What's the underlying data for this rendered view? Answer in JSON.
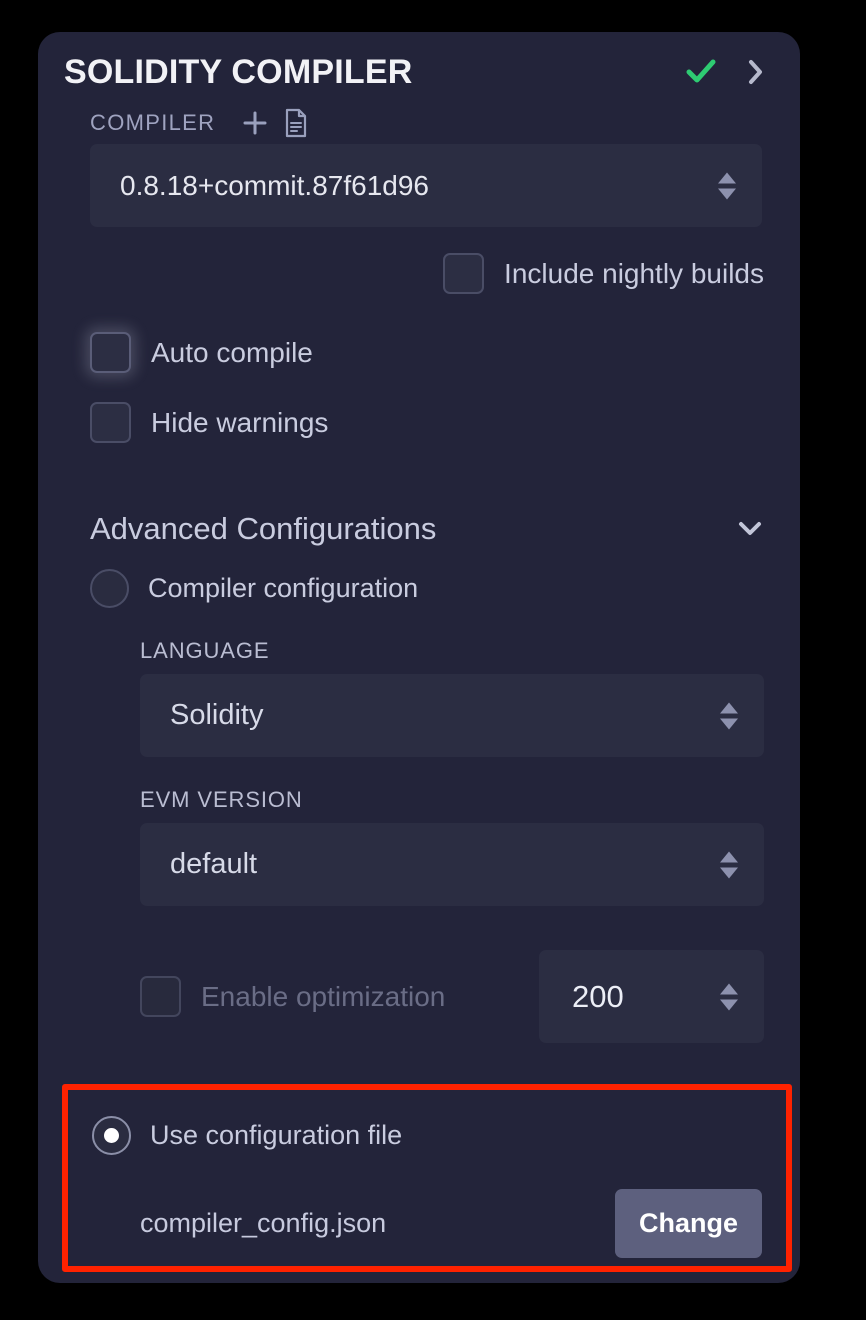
{
  "header": {
    "title": "SOLIDITY COMPILER",
    "status_icon": "check-icon",
    "status_color": "#2ecb72",
    "expand_icon": "chevron-right-icon"
  },
  "compiler_section": {
    "label": "COMPILER",
    "add_icon": "plus-icon",
    "file_icon": "file-document-icon",
    "version": "0.8.18+commit.87f61d96",
    "nightly": {
      "label": "Include nightly builds",
      "checked": false
    }
  },
  "options": [
    {
      "label": "Auto compile",
      "checked": false,
      "focused": true
    },
    {
      "label": "Hide warnings",
      "checked": false,
      "focused": false
    }
  ],
  "advanced": {
    "title": "Advanced Configurations",
    "collapse_icon": "chevron-down-icon",
    "compiler_configuration": {
      "label": "Compiler configuration",
      "selected": false
    },
    "language": {
      "label": "LANGUAGE",
      "value": "Solidity"
    },
    "evm": {
      "label": "EVM VERSION",
      "value": "default"
    },
    "optimization": {
      "label": "Enable optimization",
      "checked": false,
      "disabled": true,
      "runs": "200"
    },
    "use_config_file": {
      "label": "Use configuration file",
      "selected": true,
      "filename": "compiler_config.json",
      "change_button": "Change",
      "highlight_color": "#ff2200"
    }
  },
  "colors": {
    "panel_bg": "#23243a",
    "field_bg": "#2b2d42",
    "accent_green": "#2ecb72",
    "button_bg": "#5d607e",
    "text_primary": "#e6e7ef",
    "text_muted": "#9fa3c0"
  }
}
